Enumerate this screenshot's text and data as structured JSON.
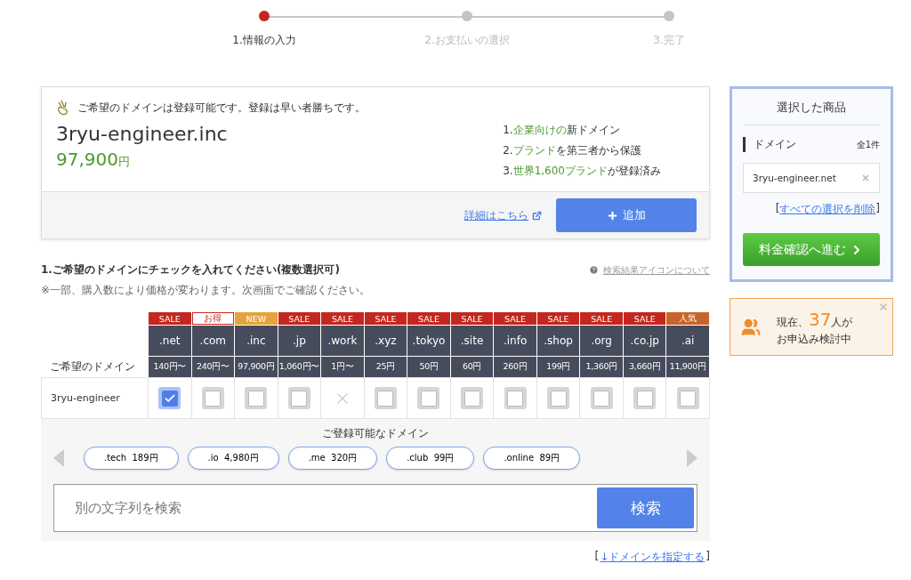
{
  "stepper": [
    {
      "label": "1.情報の入力",
      "selected": true
    },
    {
      "label": "2.お支払いの選択",
      "selected": false
    },
    {
      "label": "3.完了",
      "selected": false
    }
  ],
  "result_card": {
    "notice": "ご希望のドメインは登録可能です。登録は早い者勝ちです。",
    "domain": "3ryu-engineer.inc",
    "price": "97,900",
    "currency": "円",
    "features": [
      [
        {
          "text": "1.",
          "highlight": false
        },
        {
          "text": "企業向けの",
          "highlight": true
        },
        {
          "text": "新ドメイン",
          "highlight": false
        }
      ],
      [
        {
          "text": "2.",
          "highlight": false
        },
        {
          "text": "ブランド",
          "highlight": true
        },
        {
          "text": "を第三者から保護",
          "highlight": false
        }
      ],
      [
        {
          "text": "3.",
          "highlight": false
        },
        {
          "text": "世界1,600ブランド",
          "highlight": true
        },
        {
          "text": "が登録済み",
          "highlight": false
        }
      ]
    ],
    "details_link": "詳細はこちら",
    "add_button": "追加"
  },
  "section": {
    "heading": "1.ご希望のドメインにチェックを入れてください(複数選択可)",
    "help_link": "検索結果アイコンについて",
    "note": "※一部、購入数により価格が変わります。次画面でご確認ください。"
  },
  "table": {
    "row_header": "ご希望のドメイン",
    "columns": [
      {
        "tag": "SALE",
        "kind": "sale",
        "tld": ".net",
        "price": "140円〜"
      },
      {
        "tag": "お得",
        "kind": "deal",
        "tld": ".com",
        "price": "240円〜"
      },
      {
        "tag": "NEW",
        "kind": "new",
        "tld": ".inc",
        "price": "97,900円"
      },
      {
        "tag": "SALE",
        "kind": "sale",
        "tld": ".jp",
        "price": "1,060円〜"
      },
      {
        "tag": "SALE",
        "kind": "sale",
        "tld": ".work",
        "price": "1円〜"
      },
      {
        "tag": "SALE",
        "kind": "sale",
        "tld": ".xyz",
        "price": "25円"
      },
      {
        "tag": "SALE",
        "kind": "sale",
        "tld": ".tokyo",
        "price": "50円"
      },
      {
        "tag": "SALE",
        "kind": "sale",
        "tld": ".site",
        "price": "60円"
      },
      {
        "tag": "SALE",
        "kind": "sale",
        "tld": ".info",
        "price": "260円"
      },
      {
        "tag": "SALE",
        "kind": "sale",
        "tld": ".shop",
        "price": "199円"
      },
      {
        "tag": "SALE",
        "kind": "sale",
        "tld": ".org",
        "price": "1,360円"
      },
      {
        "tag": "SALE",
        "kind": "sale",
        "tld": ".co.jp",
        "price": "3,660円"
      },
      {
        "tag": "人気",
        "kind": "popular",
        "tld": ".ai",
        "price": "11,900円"
      }
    ],
    "rows": [
      {
        "name": "3ryu-engineer",
        "cells": [
          {
            "kind": "checkbox",
            "checked": true
          },
          {
            "kind": "checkbox",
            "checked": false
          },
          {
            "kind": "checkbox",
            "checked": false
          },
          {
            "kind": "checkbox",
            "checked": false
          },
          {
            "kind": "unavailable"
          },
          {
            "kind": "checkbox",
            "checked": false
          },
          {
            "kind": "checkbox",
            "checked": false
          },
          {
            "kind": "checkbox",
            "checked": false
          },
          {
            "kind": "checkbox",
            "checked": false
          },
          {
            "kind": "checkbox",
            "checked": false
          },
          {
            "kind": "checkbox",
            "checked": false
          },
          {
            "kind": "checkbox",
            "checked": false
          },
          {
            "kind": "checkbox",
            "checked": false
          }
        ]
      }
    ]
  },
  "suggestions": {
    "title": "ご登録可能なドメイン",
    "items": [
      {
        "tld": ".tech",
        "price": "189円"
      },
      {
        "tld": ".io",
        "price": "4,980円"
      },
      {
        "tld": ".me",
        "price": "320円"
      },
      {
        "tld": ".club",
        "price": "99円"
      },
      {
        "tld": ".online",
        "price": "89円"
      }
    ]
  },
  "search": {
    "placeholder": "別の文字列を検索",
    "button": "検索"
  },
  "specify_link": {
    "open": "[",
    "text": "↓ドメインを指定する",
    "close": "]"
  },
  "cart": {
    "title": "選択した商品",
    "section": "ドメイン",
    "count": "全1件",
    "items": [
      "3ryu-engineer.net"
    ],
    "clear_open": "[",
    "clear_link": "すべての選択を削除",
    "clear_close": "]",
    "proceed_button": "料金確認へ進む"
  },
  "notice": {
    "prefix": "現在、",
    "count": "37",
    "suffix": "人が",
    "line2": "お申込み検討中"
  }
}
